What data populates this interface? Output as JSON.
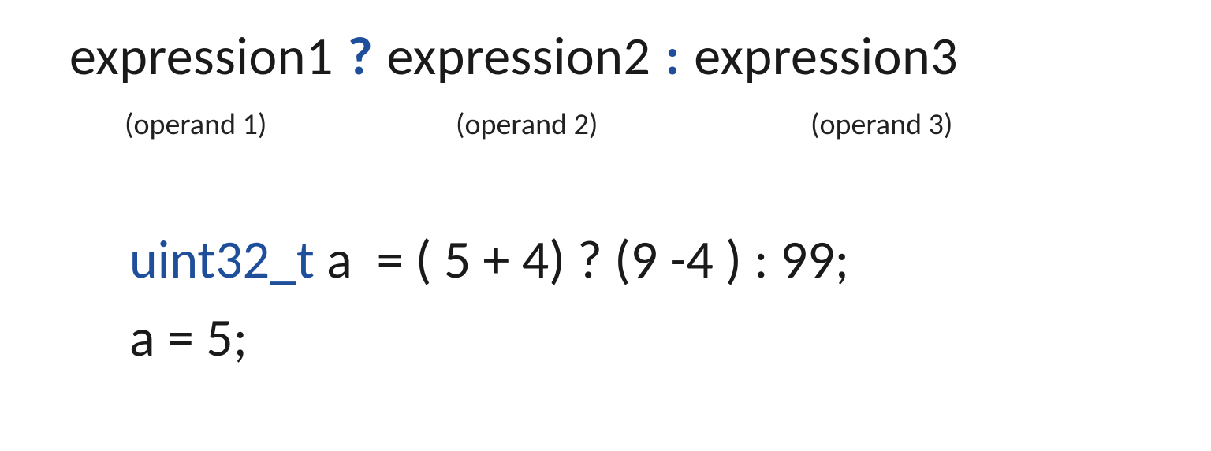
{
  "syntax": {
    "expr1": "expression1",
    "op1": "?",
    "expr2": "expression2",
    "op2": ":",
    "expr3": "expression3"
  },
  "operands": {
    "o1": "(operand 1)",
    "o2": "(operand 2)",
    "o3": "(operand 3)"
  },
  "code": {
    "type_kw": "uint32_t",
    "line1_rest": " a  = ( 5 + 4) ? (9 -4 ) : 99;",
    "line2": "a = 5;"
  }
}
